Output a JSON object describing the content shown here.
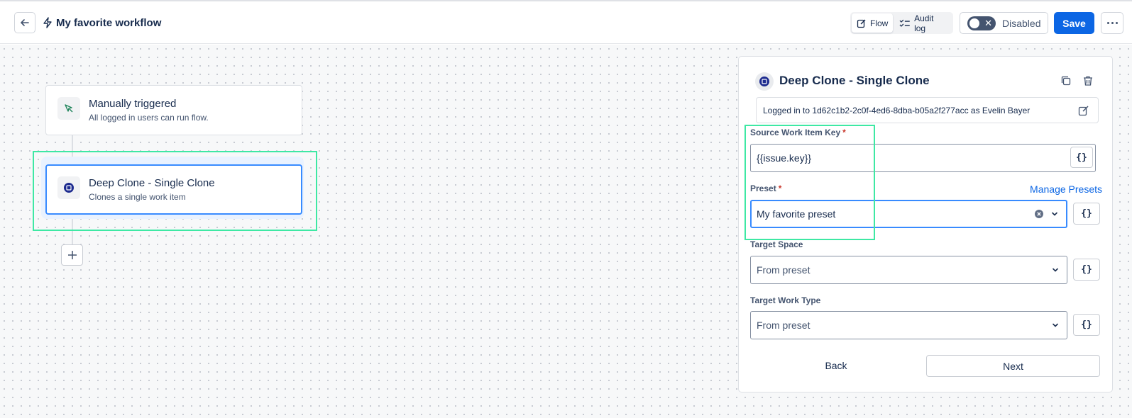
{
  "header": {
    "title": "My favorite workflow",
    "tabs": [
      {
        "label": "Flow",
        "icon": "edit-icon",
        "active": true
      },
      {
        "label": "Audit log",
        "icon": "list-check-icon",
        "active": false
      }
    ],
    "toggle_label": "Disabled",
    "toggle_state": "off",
    "save_label": "Save"
  },
  "canvas": {
    "nodes": [
      {
        "title": "Manually triggered",
        "subtitle": "All logged in users can run flow.",
        "icon": "cursor-click-icon"
      },
      {
        "title": "Deep Clone - Single Clone",
        "subtitle": "Clones a single work item",
        "icon": "deep-clone-app-icon",
        "selected": true
      }
    ]
  },
  "panel": {
    "title": "Deep Clone - Single Clone",
    "login_text": "Logged in to 1d62c1b2-2c0f-4ed6-8dba-b05a2f277acc as Evelin Bayer",
    "fields": {
      "source_key": {
        "label": "Source Work Item Key",
        "value": "{{issue.key}}",
        "required": true
      },
      "preset": {
        "label": "Preset",
        "value": "My favorite preset",
        "required": true,
        "link": "Manage Presets"
      },
      "target_space": {
        "label": "Target Space",
        "placeholder": "From preset"
      },
      "target_work_type": {
        "label": "Target Work Type",
        "placeholder": "From preset"
      }
    },
    "brace_label": "{}",
    "back_label": "Back",
    "next_label": "Next"
  },
  "colors": {
    "accent": "#0c66e4",
    "highlight": "#3ee8a4",
    "focus": "#388bff"
  }
}
